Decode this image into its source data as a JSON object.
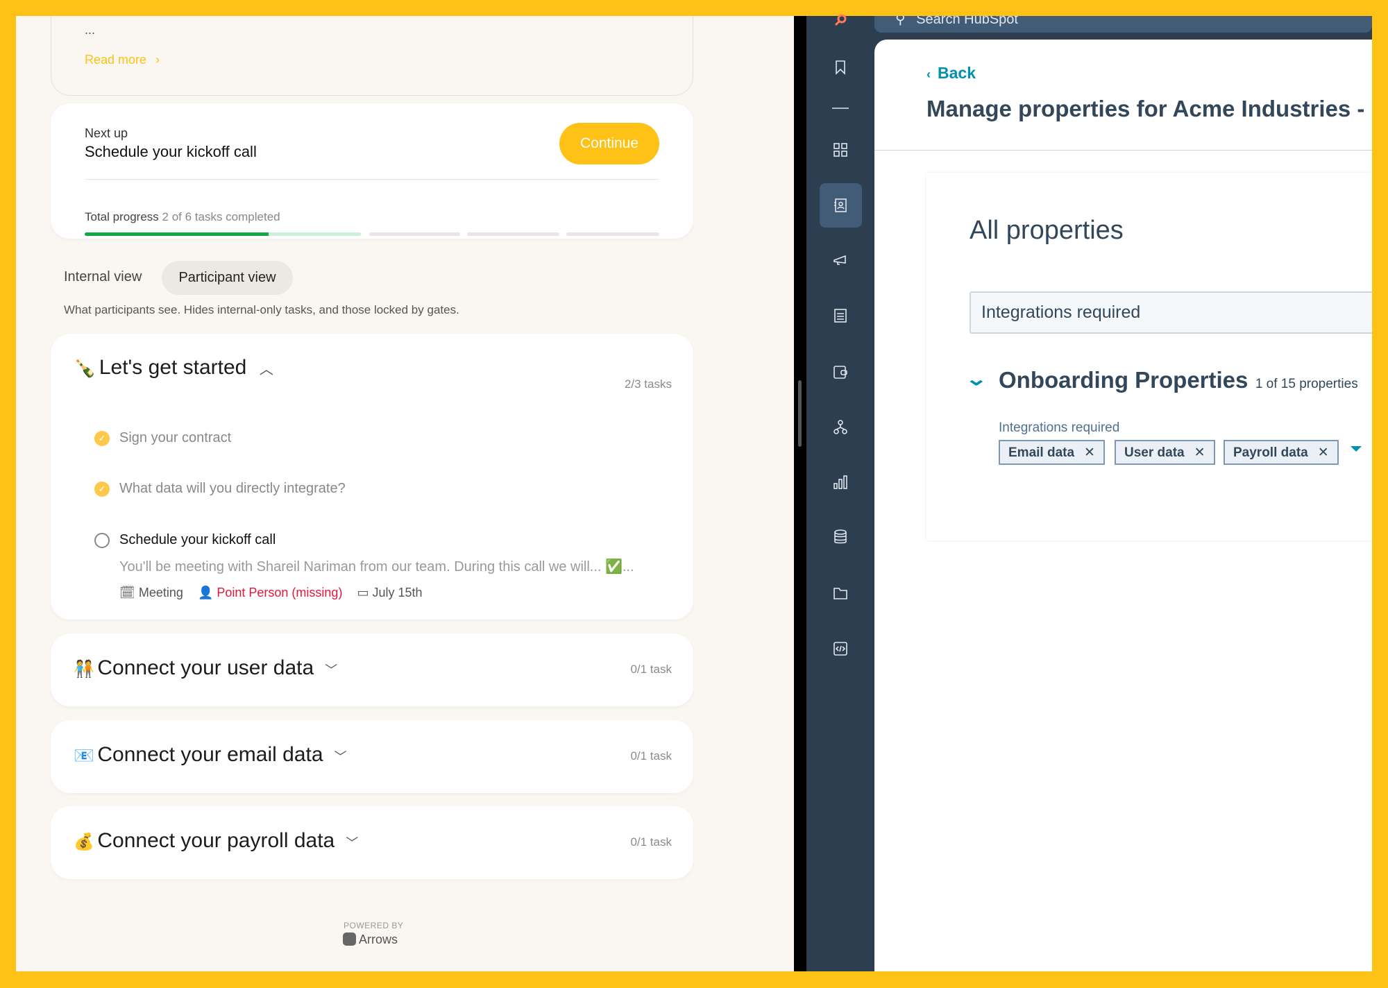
{
  "left": {
    "intro": {
      "ellipsis": "...",
      "read_more": "Read more"
    },
    "next_up": {
      "label": "Next up",
      "title": "Schedule your kickoff call",
      "continue": "Continue",
      "progress_label": "Total progress",
      "progress_text": "2 of 6 tasks completed",
      "completed": 2,
      "total": 6
    },
    "tabs": [
      {
        "label": "Internal view",
        "active": false
      },
      {
        "label": "Participant view",
        "active": true
      }
    ],
    "view_description": "What participants see. Hides internal-only tasks, and those locked by gates.",
    "sections": [
      {
        "emoji": "🍾",
        "title": "Let's get started",
        "count": "2/3 tasks",
        "expanded": true,
        "tasks": [
          {
            "title": "Sign your contract",
            "done": true
          },
          {
            "title": "What data will you directly integrate?",
            "done": true
          },
          {
            "title": "Schedule your kickoff call",
            "done": false,
            "description": "You'll be meeting with Shareil Nariman from our team.  During this call we will... ✅...",
            "meta": {
              "type": "Meeting",
              "owner": "Point Person (missing)",
              "date": "July 15th"
            }
          }
        ]
      },
      {
        "emoji": "🧑‍🤝‍🧑",
        "title": "Connect your user data",
        "count": "0/1 task",
        "expanded": false
      },
      {
        "emoji": "📧",
        "title": "Connect your email data",
        "count": "0/1 task",
        "expanded": false
      },
      {
        "emoji": "💰",
        "title": "Connect your payroll data",
        "count": "0/1 task",
        "expanded": false
      }
    ],
    "footer": {
      "powered_by": "POWERED BY",
      "brand": "Arrows"
    }
  },
  "right": {
    "search_placeholder": "Search HubSpot",
    "back": "Back",
    "title": "Manage properties for Acme Industries -",
    "heading": "All properties",
    "filter_value": "Integrations required",
    "group": {
      "title": "Onboarding Properties",
      "count": "1 of 15 properties"
    },
    "property": {
      "label": "Integrations required",
      "values": [
        "Email data",
        "User data",
        "Payroll data"
      ]
    },
    "nav_icons": [
      "hubspot-logo",
      "bookmark",
      "divider",
      "apps",
      "contacts",
      "marketing",
      "content",
      "commerce",
      "automation",
      "reporting",
      "data",
      "library",
      "development"
    ]
  },
  "colors": {
    "accent": "#fdc215",
    "progress": "#12a844",
    "link": "#0091ae",
    "missing": "#e0173d",
    "nav": "#2d3e50"
  }
}
